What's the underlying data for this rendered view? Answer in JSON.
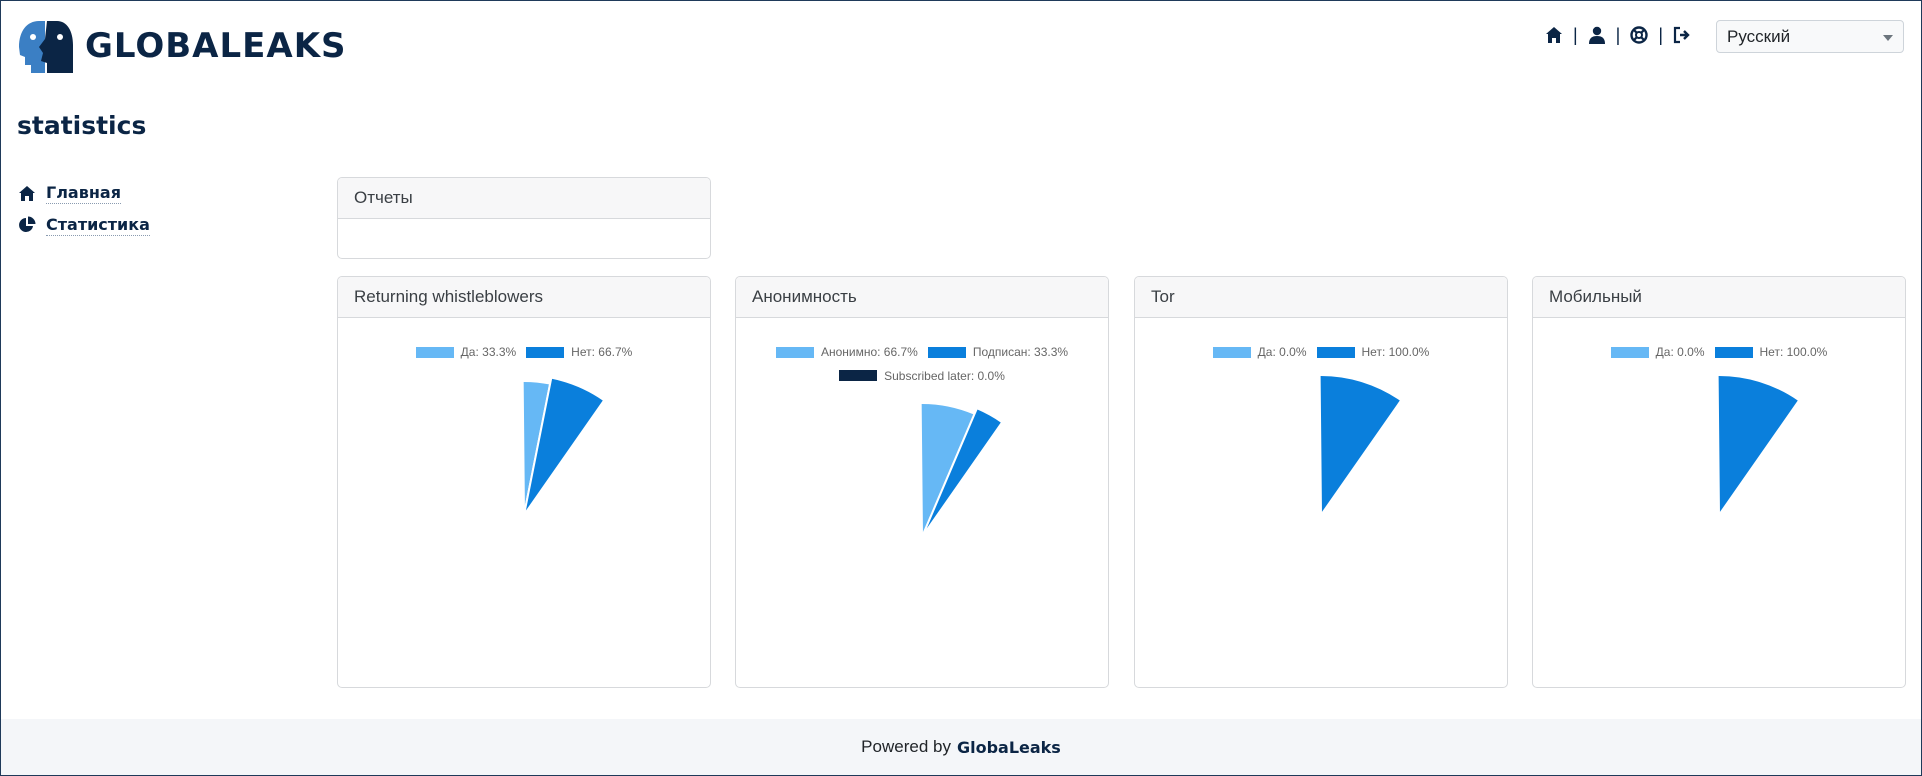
{
  "brand": {
    "name": "GLOBALEAKS"
  },
  "topnav": {
    "icons": [
      "home-icon",
      "user-icon",
      "lifebuoy-icon",
      "logout-icon"
    ],
    "separator": "|"
  },
  "language": {
    "selected": "Русский"
  },
  "page": {
    "title": "statistics"
  },
  "sidebar": {
    "items": [
      {
        "label": "Главная",
        "icon": "home-icon"
      },
      {
        "label": "Статистика",
        "icon": "pie-chart-icon"
      }
    ]
  },
  "reports_card": {
    "title": "Отчеты"
  },
  "colors": {
    "light": "#66b8f5",
    "mid": "#0a7fdc",
    "dark": "#0b2545",
    "brand": "#0b2545"
  },
  "chart_data": [
    {
      "type": "pie",
      "title": "Returning whistleblowers",
      "series": [
        {
          "name": "Да",
          "value": 33.3,
          "label": "Да: 33.3%",
          "color": "#66b8f5"
        },
        {
          "name": "Нет",
          "value": 66.7,
          "label": "Нет: 66.7%",
          "color": "#0a7fdc"
        }
      ]
    },
    {
      "type": "pie",
      "title": "Анонимность",
      "series": [
        {
          "name": "Анонимно",
          "value": 66.7,
          "label": "Анонимно: 66.7%",
          "color": "#66b8f5"
        },
        {
          "name": "Подписан",
          "value": 33.3,
          "label": "Подписан: 33.3%",
          "color": "#0a7fdc"
        },
        {
          "name": "Subscribed later",
          "value": 0.0,
          "label": "Subscribed later: 0.0%",
          "color": "#0b2545"
        }
      ]
    },
    {
      "type": "pie",
      "title": "Tor",
      "series": [
        {
          "name": "Да",
          "value": 0.0,
          "label": "Да: 0.0%",
          "color": "#66b8f5"
        },
        {
          "name": "Нет",
          "value": 100.0,
          "label": "Нет: 100.0%",
          "color": "#0a7fdc"
        }
      ]
    },
    {
      "type": "pie",
      "title": "Мобильный",
      "series": [
        {
          "name": "Да",
          "value": 0.0,
          "label": "Да: 0.0%",
          "color": "#66b8f5"
        },
        {
          "name": "Нет",
          "value": 100.0,
          "label": "Нет: 100.0%",
          "color": "#0a7fdc"
        }
      ]
    }
  ],
  "footer": {
    "prefix": "Powered by",
    "brand": "GlobaLeaks"
  }
}
